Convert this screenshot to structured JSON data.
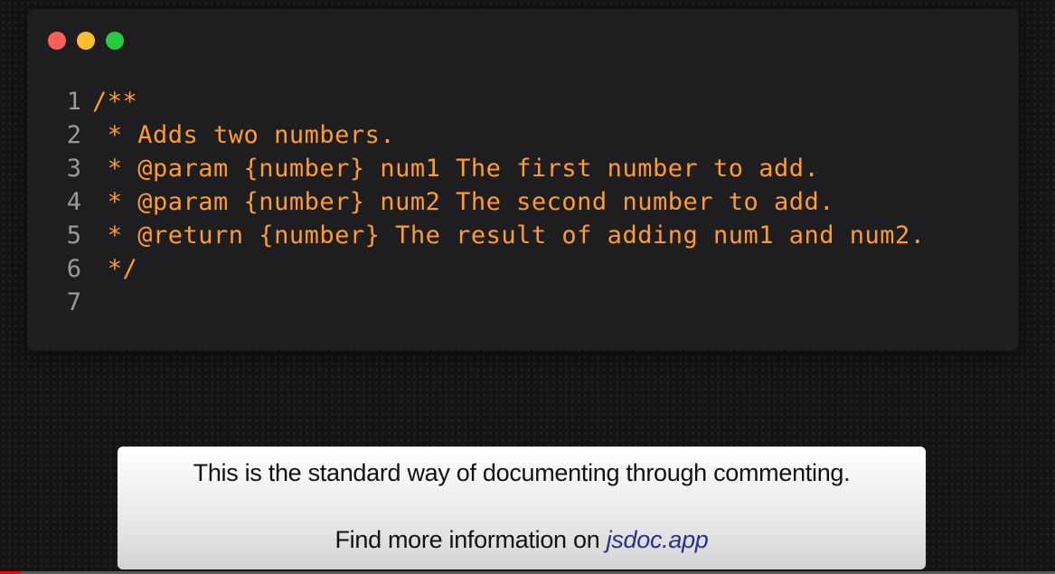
{
  "window": {
    "traffic_lights": [
      {
        "name": "close",
        "color": "#ff5f57"
      },
      {
        "name": "minimize",
        "color": "#febc2e"
      },
      {
        "name": "maximize",
        "color": "#28c840"
      }
    ]
  },
  "code": {
    "lines": [
      {
        "number": "1",
        "text": "/**"
      },
      {
        "number": "2",
        "text": " * Adds two numbers."
      },
      {
        "number": "3",
        "text": " * @param {number} num1 The first number to add."
      },
      {
        "number": "4",
        "text": " * @param {number} num2 The second number to add."
      },
      {
        "number": "5",
        "text": " * @return {number} The result of adding num1 and num2."
      },
      {
        "number": "6",
        "text": " */"
      },
      {
        "number": "7",
        "text": ""
      }
    ],
    "text_color": "#ff9b2f",
    "line_number_color": "#9a9a9a"
  },
  "caption": {
    "line1": "This is the standard way of documenting through commenting.",
    "line2_prefix": "Find more information on",
    "link": "jsdoc.app",
    "link_color": "#2a318c"
  },
  "video": {
    "progress_fraction": 0.02
  }
}
